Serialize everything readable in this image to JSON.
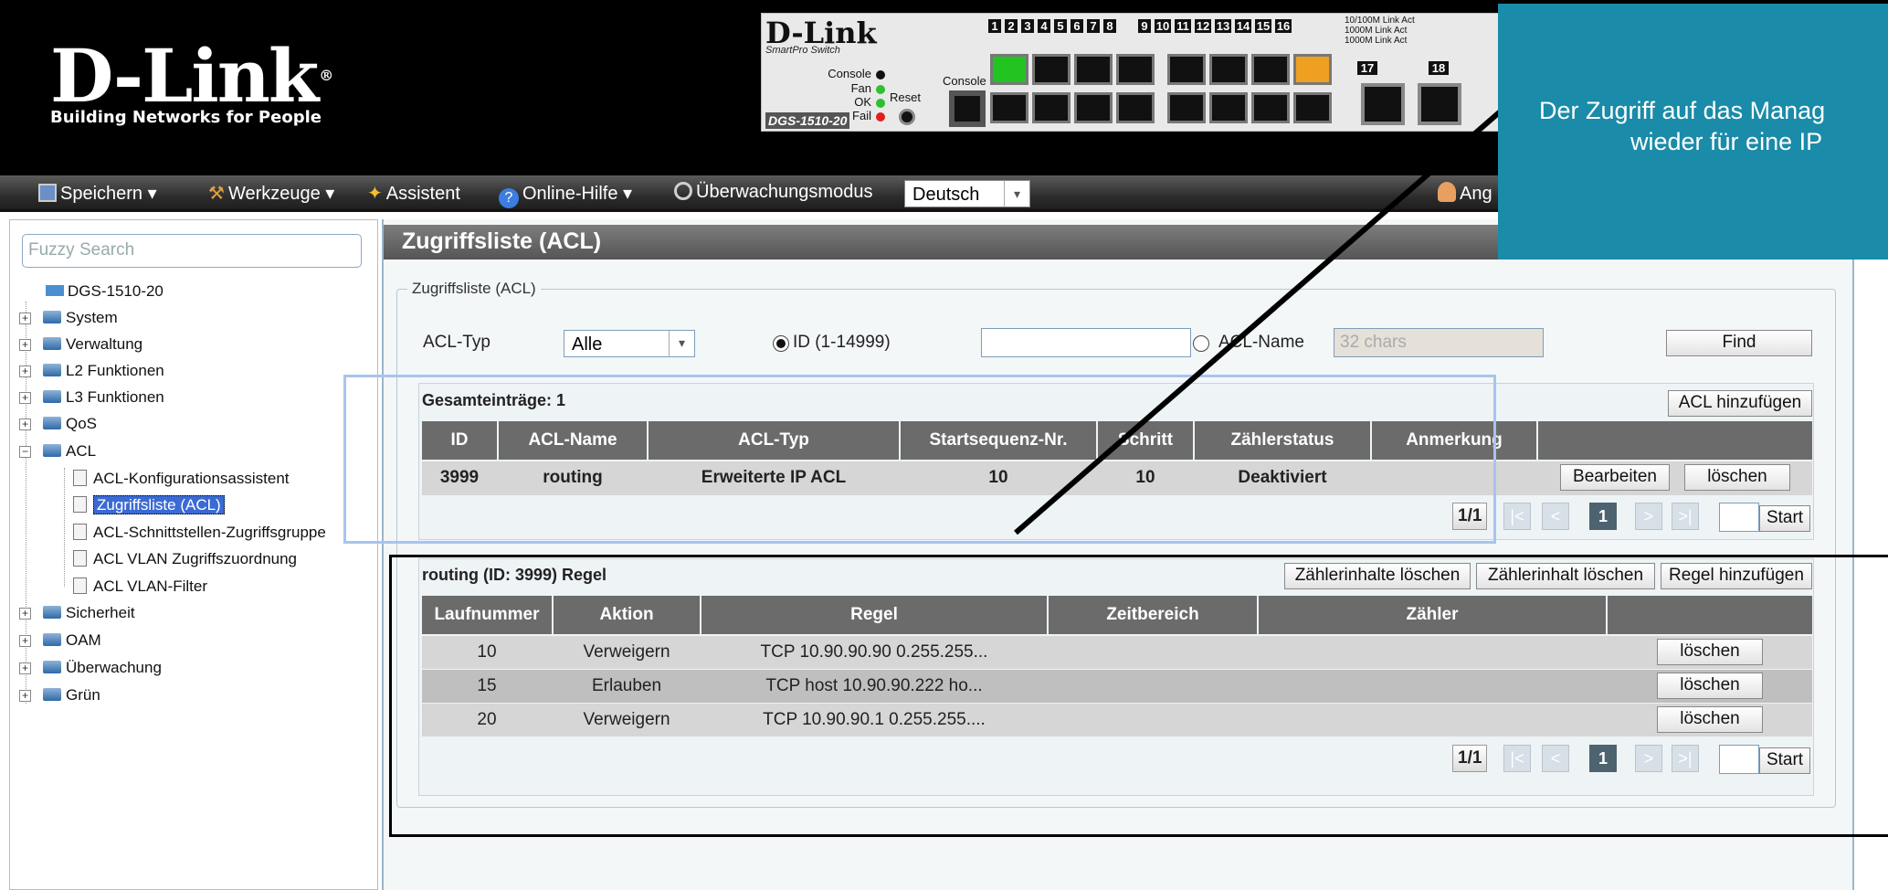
{
  "header": {
    "brand": "D-Link",
    "registered": "®",
    "tagline": "Building Networks for People"
  },
  "device": {
    "brand": "D-Link",
    "series": "SmartPro Switch",
    "model": "DGS-1510-20",
    "labels": {
      "console": "Console",
      "fan": "Fan",
      "ok": "OK",
      "fail": "Fail",
      "reset": "Reset",
      "console_port": "Console"
    },
    "port_numbers": [
      "1",
      "2",
      "3",
      "4",
      "5",
      "6",
      "7",
      "8",
      "9",
      "10",
      "11",
      "12",
      "13",
      "14",
      "15",
      "16"
    ],
    "sfp_numbers": [
      "17",
      "18"
    ],
    "legend": [
      "10/100M",
      "Link",
      "Act",
      "1000M",
      "Link",
      "Act",
      "1000M",
      "Link",
      "Act"
    ]
  },
  "toolbar": {
    "save": "Speichern",
    "tools": "Werkzeuge",
    "wizard": "Assistent",
    "help": "Online-Hilfe",
    "monitor": "Überwachungsmodus",
    "language": "Deutsch",
    "user": "Ang"
  },
  "sidebar": {
    "search_placeholder": "Fuzzy Search",
    "root": "DGS-1510-20",
    "items": [
      "System",
      "Verwaltung",
      "L2 Funktionen",
      "L3 Funktionen",
      "QoS",
      "ACL"
    ],
    "acl_children": [
      "ACL-Konfigurationsassistent",
      "Zugriffsliste (ACL)",
      "ACL-Schnittstellen-Zugriffsgruppe",
      "ACL VLAN Zugriffszuordnung",
      "ACL VLAN-Filter"
    ],
    "items_after": [
      "Sicherheit",
      "OAM",
      "Überwachung",
      "Grün"
    ]
  },
  "main": {
    "title": "Zugriffsliste (ACL)",
    "fieldset_legend": "Zugriffsliste (ACL)",
    "acl_type_label": "ACL-Typ",
    "acl_type_value": "Alle",
    "radio_id_label": "ID (1-14999)",
    "radio_name_label": "ACL-Name",
    "name_placeholder": "32 chars",
    "find": "Find",
    "total_entries": "Gesamteinträge: 1",
    "add_acl": "ACL hinzufügen",
    "acl_table": {
      "headers": [
        "ID",
        "ACL-Name",
        "ACL-Typ",
        "Startsequenz-Nr.",
        "Schritt",
        "Zählerstatus",
        "Anmerkung",
        ""
      ],
      "rows": [
        {
          "id": "3999",
          "name": "routing",
          "type": "Erweiterte IP ACL",
          "start": "10",
          "step": "10",
          "counter": "Deaktiviert",
          "note": "",
          "edit": "Bearbeiten",
          "delete": "löschen"
        }
      ]
    },
    "pager1": {
      "page": "1/1",
      "first": "|<",
      "prev": "<",
      "current": "1",
      "next": ">",
      "last": ">|",
      "start": "Start"
    },
    "rule_title": "routing (ID: 3999) Regel",
    "clear_counters": "Zählerinhalte löschen",
    "clear_counter": "Zählerinhalt löschen",
    "add_rule": "Regel hinzufügen",
    "rule_table": {
      "headers": [
        "Laufnummer",
        "Aktion",
        "Regel",
        "Zeitbereich",
        "Zähler",
        ""
      ],
      "rows": [
        {
          "seq": "10",
          "action": "Verweigern",
          "rule": "TCP 10.90.90.90 0.255.255...",
          "time": "",
          "counter": "",
          "delete": "löschen"
        },
        {
          "seq": "15",
          "action": "Erlauben",
          "rule": "TCP host 10.90.90.222 ho...",
          "time": "",
          "counter": "",
          "delete": "löschen"
        },
        {
          "seq": "20",
          "action": "Verweigern",
          "rule": "TCP 10.90.90.1 0.255.255....",
          "time": "",
          "counter": "",
          "delete": "löschen"
        }
      ]
    },
    "pager2": {
      "page": "1/1",
      "first": "|<",
      "prev": "<",
      "current": "1",
      "next": ">",
      "last": ">|",
      "start": "Start"
    }
  },
  "callout": {
    "line1": "Der Zugriff auf das Manag",
    "line2": "wieder für eine IP"
  },
  "colors": {
    "callout": "#1a8ba8",
    "header_bg": "#000000",
    "table_header": "#6b6b6b",
    "selection": "#3a6ad4"
  }
}
